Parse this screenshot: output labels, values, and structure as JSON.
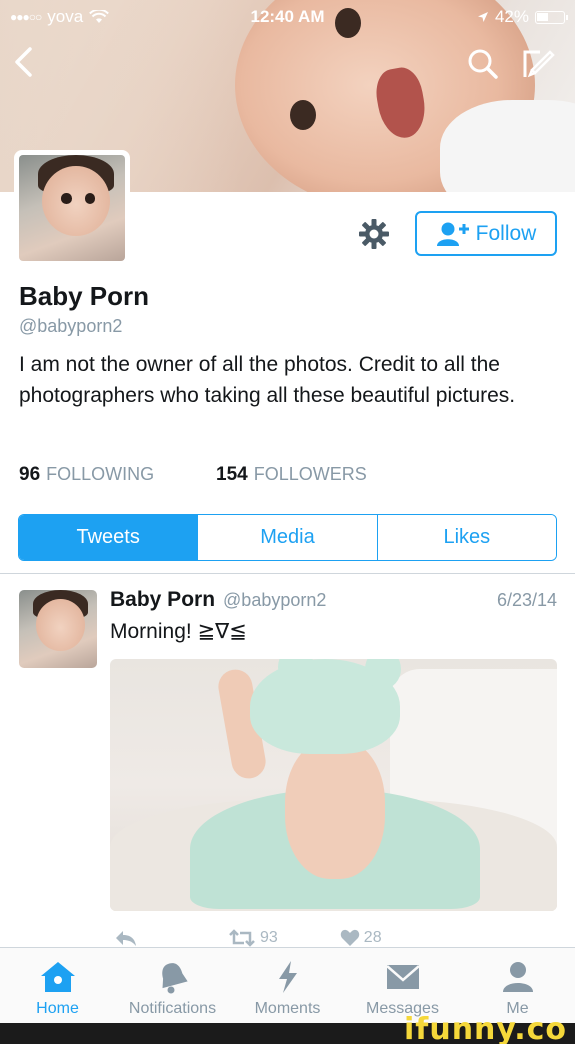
{
  "status_bar": {
    "carrier": "yova",
    "signal_dots": "●●●○○",
    "time": "12:40 AM",
    "battery": "42%"
  },
  "profile": {
    "name": "Baby Porn",
    "handle": "@babyporn2",
    "bio": "I am not the owner of all the photos. Credit to all the photographers who taking all these beautiful pictures.",
    "following_count": "96",
    "following_label": "FOLLOWING",
    "followers_count": "154",
    "followers_label": "FOLLOWERS",
    "follow_label": "Follow"
  },
  "tabs": [
    "Tweets",
    "Media",
    "Likes"
  ],
  "tweet": {
    "name": "Baby Porn",
    "handle": "@babyporn2",
    "date": "6/23/14",
    "text": "Morning! ≧∇≦",
    "retweets": "93",
    "likes": "28"
  },
  "tabbar": [
    "Home",
    "Notifications",
    "Moments",
    "Messages",
    "Me"
  ],
  "watermark": "ifunny.co",
  "colors": {
    "accent": "#1da1f2",
    "muted": "#8899a6",
    "text": "#14171a"
  }
}
